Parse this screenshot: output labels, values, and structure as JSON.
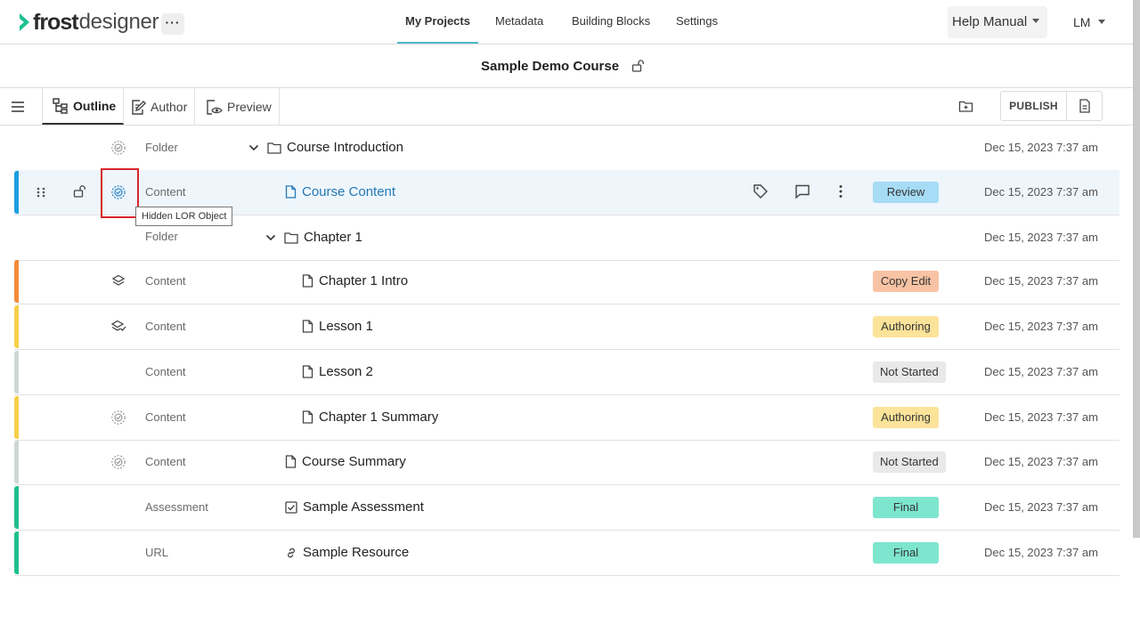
{
  "app": {
    "logo_part1": "frost",
    "logo_part2": "designer",
    "more_label": "···",
    "brand_color": "#1fbf8f"
  },
  "nav": {
    "items": [
      {
        "label": "My Projects",
        "active": true
      },
      {
        "label": "Metadata"
      },
      {
        "label": "Building Blocks"
      },
      {
        "label": "Settings"
      }
    ],
    "help_label": "Help Manual",
    "user_label": "LM"
  },
  "course": {
    "title": "Sample Demo Course",
    "lock_icon": "unlock-icon"
  },
  "toolbar": {
    "tabs": [
      {
        "label": "Outline",
        "icon": "outline-tree-icon",
        "active": true
      },
      {
        "label": "Author",
        "icon": "edit-doc-icon"
      },
      {
        "label": "Preview",
        "icon": "preview-eye-icon"
      }
    ],
    "publish_label": "PUBLISH"
  },
  "tooltip": "Hidden LOR Object",
  "rows": [
    {
      "type": "Folder",
      "name": "Course Introduction",
      "icon": "folder-icon",
      "status_icon": "hidden-lor-icon",
      "date": "Dec 15, 2023 7:37 am",
      "expanded": true
    },
    {
      "type": "Content",
      "name": "Course Content",
      "icon": "file-icon",
      "status_icon": "hidden-lor-icon",
      "badge": "Review",
      "badge_color": "#a6dcf5",
      "stripe": "#1a9ee0",
      "date": "Dec 15, 2023 7:37 am",
      "selected": true
    },
    {
      "type": "Folder",
      "name": "Chapter 1",
      "icon": "folder-icon",
      "date": "Dec 15, 2023 7:37 am",
      "expanded": true
    },
    {
      "type": "Content",
      "name": "Chapter 1 Intro",
      "icon": "file-icon",
      "status_icon": "layers-icon",
      "badge": "Copy Edit",
      "badge_color": "#f8c3a4",
      "stripe": "#f28b3a",
      "date": "Dec 15, 2023 7:37 am"
    },
    {
      "type": "Content",
      "name": "Lesson 1",
      "icon": "file-icon",
      "status_icon": "layers-check-icon",
      "badge": "Authoring",
      "badge_color": "#fbe39a",
      "stripe": "#f6cf4a",
      "date": "Dec 15, 2023 7:37 am"
    },
    {
      "type": "Content",
      "name": "Lesson 2",
      "icon": "file-icon",
      "badge": "Not Started",
      "badge_color": "#e9e9e9",
      "stripe": "#cfd6d8",
      "date": "Dec 15, 2023 7:37 am"
    },
    {
      "type": "Content",
      "name": "Chapter 1 Summary",
      "icon": "file-icon",
      "status_icon": "hidden-lor-icon",
      "badge": "Authoring",
      "badge_color": "#fbe39a",
      "stripe": "#f6cf4a",
      "date": "Dec 15, 2023 7:37 am"
    },
    {
      "type": "Content",
      "name": "Course Summary",
      "icon": "file-icon",
      "status_icon": "hidden-lor-icon",
      "badge": "Not Started",
      "badge_color": "#e9e9e9",
      "stripe": "#cfd6d8",
      "date": "Dec 15, 2023 7:37 am"
    },
    {
      "type": "Assessment",
      "name": "Sample Assessment",
      "icon": "checkbox-icon",
      "badge": "Final",
      "badge_color": "#7ee6cf",
      "stripe": "#1fbf8f",
      "date": "Dec 15, 2023 7:37 am"
    },
    {
      "type": "URL",
      "name": "Sample Resource",
      "icon": "link-icon",
      "badge": "Final",
      "badge_color": "#7ee6cf",
      "stripe": "#1fbf8f",
      "date": "Dec 15, 2023 7:37 am"
    }
  ]
}
